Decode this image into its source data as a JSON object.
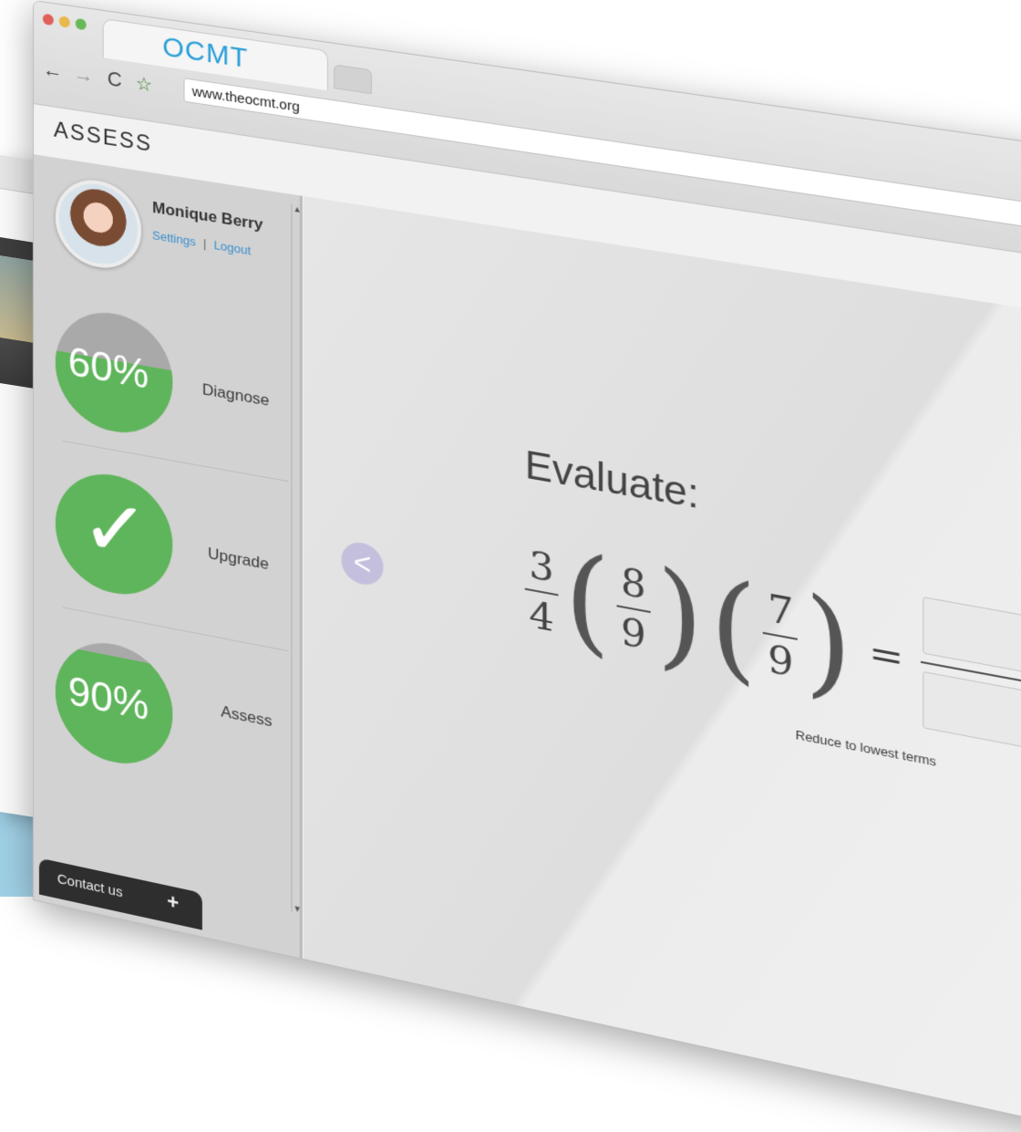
{
  "browser": {
    "tab_title": "OCMT",
    "url": "www.theocmt.org",
    "nav": {
      "back": "←",
      "forward": "→",
      "reload": "C",
      "star": "☆"
    }
  },
  "app": {
    "title": "ASSESS"
  },
  "profile": {
    "name": "Monique Berry",
    "settings_label": "Settings",
    "separator": "|",
    "logout_label": "Logout"
  },
  "metrics": [
    {
      "label": "Diagnose",
      "value_text": "60%",
      "fill_percent": 60
    },
    {
      "label": "Upgrade",
      "completed": true,
      "fill_percent": 100
    },
    {
      "label": "Assess",
      "value_text": "90%",
      "fill_percent": 90
    }
  ],
  "contact": {
    "label": "Contact us",
    "plus": "+"
  },
  "problem": {
    "heading": "Evaluate:",
    "fractions": [
      {
        "num": "3",
        "den": "4"
      },
      {
        "num": "8",
        "den": "9"
      },
      {
        "num": "7",
        "den": "9"
      }
    ],
    "equals": "=",
    "hint": "Reduce to lowest terms"
  },
  "colors": {
    "accent": "#2a9fd8",
    "progress": "#5fb55b",
    "progress_bg": "#a9a9a9",
    "arrow": "#c3bfdc"
  },
  "icons": {
    "prev": "chevron-left-icon",
    "next": "chevron-right-icon",
    "check": "checkmark-icon"
  }
}
